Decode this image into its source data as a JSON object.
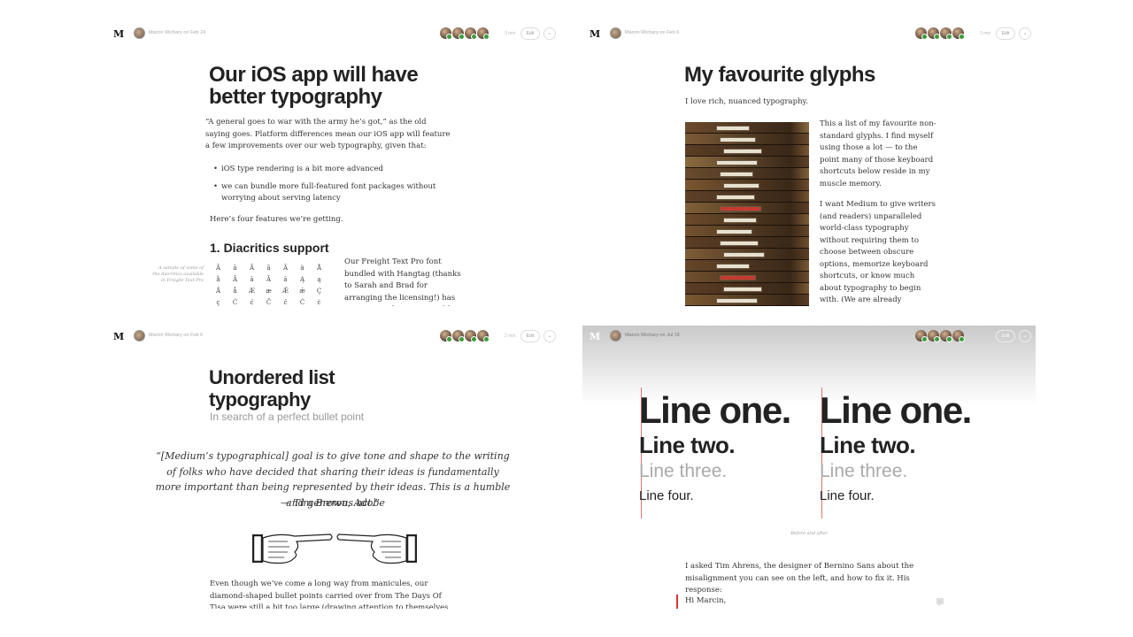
{
  "panels": [
    {
      "author_meta": "Marcin Wichary on Feb 24",
      "read_time": "3 min",
      "edit_label": "Edit",
      "title": "Our iOS app will have better typography",
      "intro": "“A general goes to war with the army he’s got,” as the old saying goes. Platform differences mean our iOS app will feature a few improvements over our web typography, given that:",
      "bullets": [
        "iOS type rendering is a bit more advanced",
        "we can bundle more full-featured font packages without worrying about serving latency"
      ],
      "after_bullets": "Here’s four features we’re getting.",
      "section_heading": "1. Diacritics support",
      "figure_caption": "A sample of some of the diacritics available in Freight Text Pro",
      "glyph_rows": [
        [
          "Â",
          "â",
          "Ã",
          "ã",
          "Ä",
          "ä",
          "Å"
        ],
        [
          "å",
          "Ā",
          "ā",
          "Ă",
          "ă",
          "Ą",
          "ą"
        ],
        [
          "Ǻ",
          "ǻ",
          "Æ",
          "æ",
          "Ǽ",
          "ǽ",
          "Ç"
        ],
        [
          "ç",
          "Ć",
          "ć",
          "Ĉ",
          "ĉ",
          "Ċ",
          "ċ"
        ]
      ],
      "side_text": "Our Freight Text Pro font bundled with Hangtag (thanks to Sarah and Brad for arranging the licensing!) has many more diacritics used by"
    },
    {
      "author_meta": "Marcin Wichary on Feb 6",
      "read_time": "3 min",
      "edit_label": "Edit",
      "title": "My favourite glyphs",
      "intro": "I love rich, nuanced typography.",
      "para1": "This a list of my favourite non-standard glyphs. I find myself using those a lot — to the point many of those keyboard shortcuts below reside in my muscle memory.",
      "para2": "I want Medium to give writers (and readers) unparalleled world-class typography without requiring them to choose between obscure options, memorize keyboard shortcuts, or know much about typography to begin with. (We are already incredibly clever about not allowing two spaces after a full"
    },
    {
      "author_meta": "Marcin Wichary on Feb 6",
      "read_time": "2 min",
      "edit_label": "Edit",
      "title": "Unordered list typography",
      "subtitle": "In search of a perfect bullet point",
      "quote": "“[Medium’s typographical] goal is to give tone and shape to the writing of folks who have decided that sharing their ideas is fundamentally more important than being represented by their ideas. This is a humble and generous act.”",
      "quote_attr": "— Tim Brown, Adobe",
      "body": "Even though we’ve come a long way from manicules, our diamond-shaped bullet points carried over from The Days Of Tisa were still a bit too large (drawing attention to themselves rather than content) and a bit too"
    },
    {
      "author_meta": "Marcin Wichary on Jul 19",
      "edit_label": "Edit",
      "line_one": "Line one.",
      "line_two": "Line two.",
      "line_three": "Line three.",
      "line_four": "Line four.",
      "figure_caption": "Before and after",
      "body": "I asked Tim Ahrens, the designer of Bernino Sans about the misalignment you can see on the left, and how to fix it. His response:",
      "blockquote_start": "Hi Marcin,"
    }
  ],
  "colors": {
    "recommend_badge": "#3a9d3a",
    "accent_red": "#d33333",
    "text": "#333333",
    "muted": "#999999"
  },
  "icons": {
    "logo": "medium-m-logo",
    "menu": "chevron-down-icon",
    "comment": "comment-icon"
  }
}
